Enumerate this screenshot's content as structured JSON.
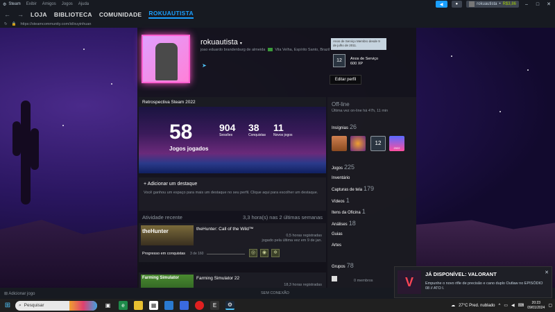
{
  "titlebar": {
    "app": "Steam",
    "menu": [
      "Exibir",
      "Amigos",
      "Jogos",
      "Ajuda"
    ],
    "username": "rokuautista",
    "balance": "R$3,86"
  },
  "nav": {
    "links": [
      "LOJA",
      "BIBLIOTECA",
      "COMUNIDADE",
      "ROKUAUTISTA"
    ],
    "url": "https://steamcommunity.com/id/xuyinhuan"
  },
  "profile": {
    "name": "rokuautista",
    "realname": "joao eduardo brandenburg de almeida",
    "location": "Vila Velha, Espírito Santo, Brazil",
    "level": "12",
    "level_tooltip": "Anos de Serviço\nMembro desde 9 de julho de 2011.",
    "badge_title": "Anos de Serviço",
    "badge_xp": "600 XP",
    "edit_button": "Editar perfil"
  },
  "retro": {
    "header": "Retrospectiva Steam 2022",
    "games_played": "58",
    "games_played_label": "Jogos jogados",
    "sessions": "904",
    "sessions_label": "Sessões",
    "achievements": "38",
    "achievements_label": "Conquistas",
    "new_games": "11",
    "new_games_label": "Novos jogos"
  },
  "highlight": {
    "title": "+ Adicionar um destaque",
    "desc": "Você ganhou um espaço para mais um destaque no seu perfil. Clique aqui para escolher um destaque."
  },
  "recent": {
    "label": "Atividade recente",
    "hours": "3,3 hora(s) nas 2 últimas semanas",
    "games": [
      {
        "name": "theHunter: Call of the Wild™",
        "capsule": "theHunter",
        "hours": "0,5 horas registradas",
        "last": "jogado pela última vez em 9 de jan.",
        "ach_label": "Progresso em conquistas",
        "ach_count": "3 de 160"
      },
      {
        "name": "Farming Simulator 22",
        "capsule": "Farming Simulator",
        "hours": "18,3 horas registradas"
      }
    ]
  },
  "side": {
    "status": "Off-line",
    "last_online": "Última vez on-line há 47h, 11 min",
    "badges_label": "Insígnias",
    "badges_count": "26",
    "badge_12": "12",
    "badge_2022": "2022",
    "items": [
      {
        "label": "Jogos",
        "count": "225"
      },
      {
        "label": "Inventário",
        "count": ""
      },
      {
        "label": "Capturas de tela",
        "count": "179"
      },
      {
        "label": "Vídeos",
        "count": "1"
      },
      {
        "label": "Itens da Oficina",
        "count": "1"
      },
      {
        "label": "Análises",
        "count": "18"
      },
      {
        "label": "Guias",
        "count": ""
      },
      {
        "label": "Artes",
        "count": ""
      }
    ],
    "groups_label": "Grupos",
    "groups_count": "78",
    "members": "0 membros"
  },
  "bottom": {
    "add_game": "Adicionar jogo",
    "status": "SEM CONEXÃO"
  },
  "toast": {
    "title": "JÁ DISPONÍVEL: VALORANT",
    "body": "Empunhe o novo rifle de precisão e cano duplo Outlaw no EPISÓDIO 08 // ATO I."
  },
  "taskbar": {
    "search_placeholder": "Pesquisar",
    "weather": "27°C  Pred. nublado",
    "time": "20:23",
    "date": "09/01/2024"
  },
  "colors": {
    "accent": "#1a9fff",
    "glow": "#ff4fc8"
  }
}
